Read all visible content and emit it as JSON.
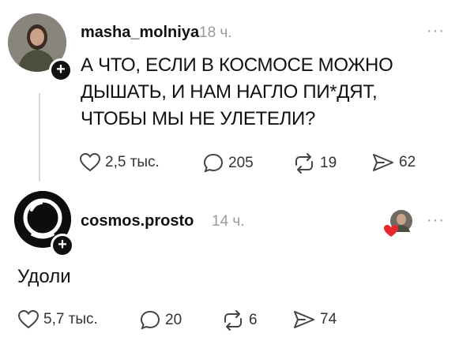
{
  "post": {
    "username": "masha_molniya",
    "time": "18 ч.",
    "text": "А ЧТО, ЕСЛИ В КОСМОСЕ МОЖНО ДЫШАТЬ, И НАМ НАГЛО ПИ*ДЯТ, ЧТОБЫ МЫ НЕ УЛЕТЕЛИ?",
    "likes": "2,5 тыс.",
    "comments": "205",
    "reposts": "19",
    "shares": "62"
  },
  "reply": {
    "username": "cosmos.prosto",
    "time": "14 ч.",
    "text": "Удоли",
    "likes": "5,7 тыс.",
    "comments": "20",
    "reposts": "6",
    "shares": "74"
  },
  "icons": {
    "like": "heart-icon",
    "comment": "comment-bubble-icon",
    "repost": "repost-icon",
    "share": "send-icon",
    "follow": "plus-icon",
    "more": "more-dots-icon"
  },
  "colors": {
    "liked_heart": "#e8262e",
    "muted": "#9a9a9a"
  },
  "more_label": "···",
  "plus_label": "+"
}
